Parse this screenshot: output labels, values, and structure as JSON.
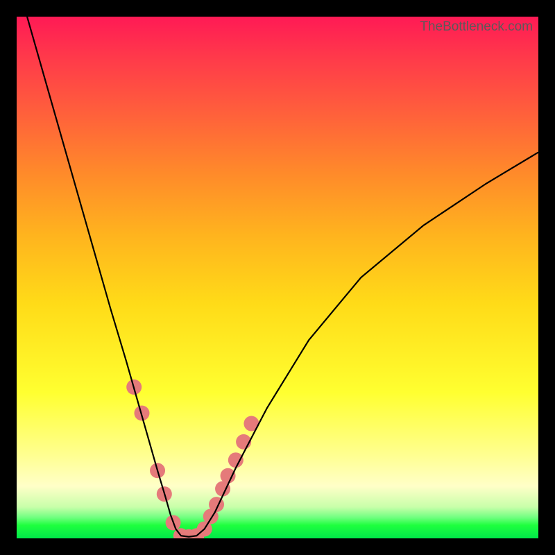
{
  "watermark": "TheBottleneck.com",
  "chart_data": {
    "type": "line",
    "title": "",
    "xlabel": "",
    "ylabel": "",
    "xlim": [
      0,
      100
    ],
    "ylim": [
      0,
      100
    ],
    "series": [
      {
        "name": "curve",
        "color": "#000000",
        "x": [
          2,
          6,
          10,
          14,
          18,
          21,
          23,
          25,
          27,
          28.5,
          29.5,
          30.5,
          31.5,
          33,
          34.5,
          36,
          38,
          42,
          48,
          56,
          66,
          78,
          90,
          100
        ],
        "y": [
          100,
          86,
          72,
          58,
          44,
          34,
          27,
          20,
          13,
          8,
          4.5,
          1.8,
          0.5,
          0.3,
          0.5,
          1.8,
          5,
          13.5,
          25,
          38,
          50,
          60,
          68,
          74
        ]
      }
    ],
    "markers": [
      {
        "name": "dots",
        "color": "#e57a7a",
        "radius": 11,
        "x": [
          22.5,
          24.0,
          27.0,
          28.3,
          30.0,
          31.5,
          33.0,
          34.5,
          36.0,
          37.2,
          38.3,
          39.5,
          40.5,
          42.0,
          43.5,
          45.0
        ],
        "y": [
          29.0,
          24.0,
          13.0,
          8.5,
          3.0,
          0.5,
          0.3,
          0.5,
          1.8,
          4.2,
          6.5,
          9.5,
          12.0,
          15.0,
          18.5,
          22.0
        ]
      }
    ]
  }
}
